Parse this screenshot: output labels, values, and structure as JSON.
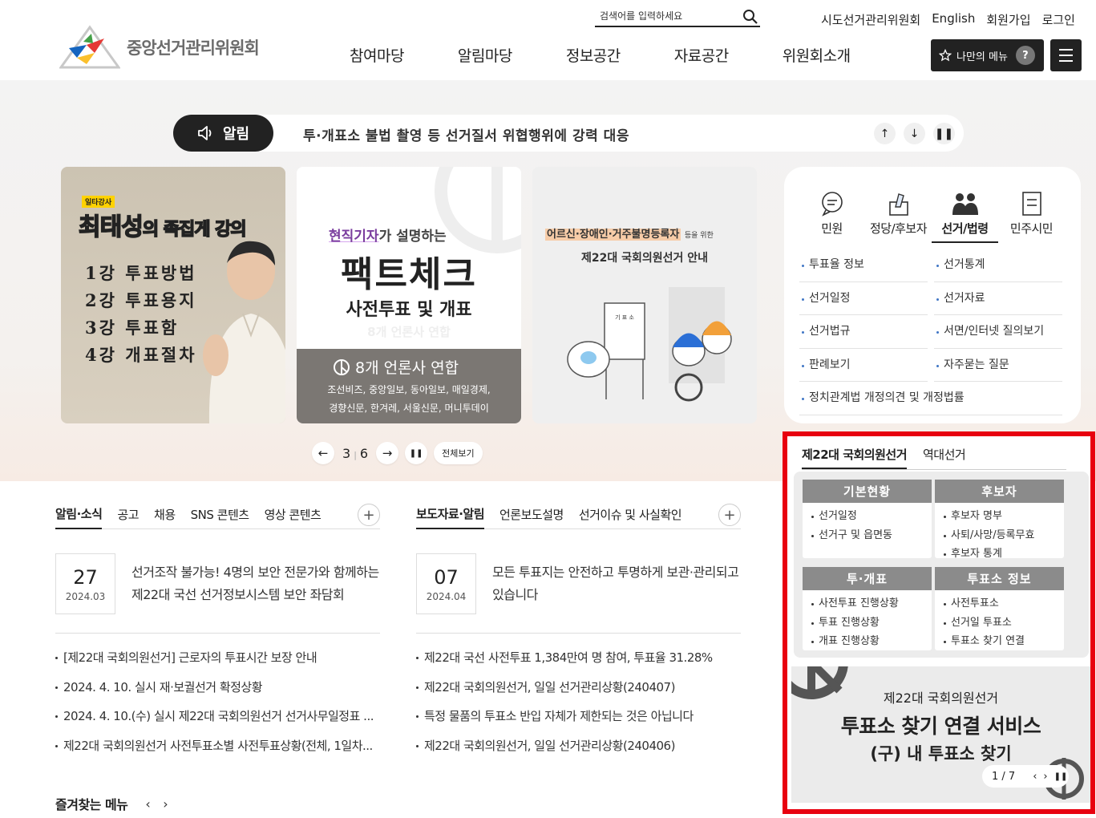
{
  "header": {
    "logo_text": "중앙선거관리위원회",
    "search_placeholder": "검색어를 입력하세요",
    "util": [
      "시도선거관리위원회",
      "English",
      "회원가입",
      "로그인"
    ],
    "gnb": [
      "참여마당",
      "알림마당",
      "정보공간",
      "자료공간",
      "위원회소개"
    ],
    "my_menu_label": "나만의 메뉴",
    "my_menu_help": "?"
  },
  "notice": {
    "label": "알림",
    "text": "투·개표소 불법 촬영 등 선거질서 위협행위에 강력 대응"
  },
  "banners": {
    "b1": {
      "tag": "일타강사",
      "title_main": "최태성",
      "title_sub": "의 족집게 강의",
      "lines": [
        "1강 투표방법",
        "2강 투표용지",
        "3강 투표함",
        "4강 개표절차"
      ]
    },
    "b2": {
      "t1_highlight": "현직기자",
      "t1_rest": "가 설명하는",
      "t2": "팩트체크",
      "t3": "사전투표 및 개표",
      "t4": "8개 언론사 연합",
      "gray_head": "8개 언론사 연합",
      "gray_lines": [
        "조선비즈, 중앙일보, 동아일보, 매일경제,",
        "경향신문, 한겨레, 서울신문, 머니투데이"
      ]
    },
    "b3": {
      "t1_highlight": "어르신·장애인·거주불명등록자",
      "t1_small": "등을 위한",
      "t2": "제22대 국회의원선거 안내",
      "sign": "기 표 소"
    }
  },
  "banner_controls": {
    "current": "3",
    "total": "6",
    "all_view": "전체보기"
  },
  "quick": {
    "tabs": [
      {
        "label": "민원",
        "icon": "speech-bubble-icon"
      },
      {
        "label": "정당/후보자",
        "icon": "ballot-hand-icon"
      },
      {
        "label": "선거/법령",
        "icon": "people-icon"
      },
      {
        "label": "민주시민",
        "icon": "document-icon"
      }
    ],
    "active_tab": "선거/법령",
    "links": [
      "투표율 정보",
      "선거통계",
      "선거일정",
      "선거자료",
      "선거법규",
      "서면/인터넷 질의보기",
      "판례보기",
      "자주묻는 질문"
    ],
    "wide_link": "정치관계법 개정의견 및 개정법률"
  },
  "election": {
    "tabs": [
      "제22대 국회의원선거",
      "역대선거"
    ],
    "boxes": [
      {
        "title": "기본현황",
        "items": [
          "선거일정",
          "선거구 및 읍면동"
        ]
      },
      {
        "title": "후보자",
        "items": [
          "후보자 명부",
          "사퇴/사망/등록무효",
          "후보자 통계"
        ]
      },
      {
        "title": "투·개표",
        "items": [
          "사전투표 진행상황",
          "투표 진행상황",
          "개표 진행상황"
        ]
      },
      {
        "title": "투표소 정보",
        "items": [
          "사전투표소",
          "선거일 투표소",
          "투표소 찾기 연결"
        ]
      }
    ],
    "banner": {
      "l1": "제22대 국회의원선거",
      "l2": "투표소 찾기 연결 서비스",
      "l3": "(구) 내 투표소 찾기",
      "pager": "1 / 7"
    }
  },
  "news_left": {
    "tabs": [
      "알림·소식",
      "공고",
      "채용",
      "SNS 콘텐츠",
      "영상 콘텐츠"
    ],
    "feature": {
      "day": "27",
      "ym": "2024.03",
      "text": "선거조작 불가능! 4명의 보안 전문가와 함께하는 제22대 국선 선거정보시스템 보안 좌담회"
    },
    "items": [
      "[제22대 국회의원선거] 근로자의 투표시간 보장 안내",
      "2024. 4. 10. 실시 재·보궐선거 확정상황",
      "2024. 4. 10.(수) 실시 제22대 국회의원선거 선거사무일정표 ...",
      "제22대 국회의원선거 사전투표소별 사전투표상황(전체, 1일차..."
    ]
  },
  "news_right": {
    "tabs": [
      "보도자료·알림",
      "언론보도설명",
      "선거이슈 및 사실확인"
    ],
    "feature": {
      "day": "07",
      "ym": "2024.04",
      "text": "모든 투표지는 안전하고 투명하게 보관·관리되고 있습니다"
    },
    "items": [
      "제22대 국선 사전투표 1,384만여 명 참여, 투표율 31.28%",
      "제22대 국회의원선거, 일일 선거관리상황(240407)",
      "특정 물품의 투표소 반입 자체가 제한되는 것은 아닙니다",
      "제22대 국회의원선거, 일일 선거관리상황(240406)"
    ]
  },
  "favorites": {
    "label": "즐겨찾는 메뉴"
  }
}
